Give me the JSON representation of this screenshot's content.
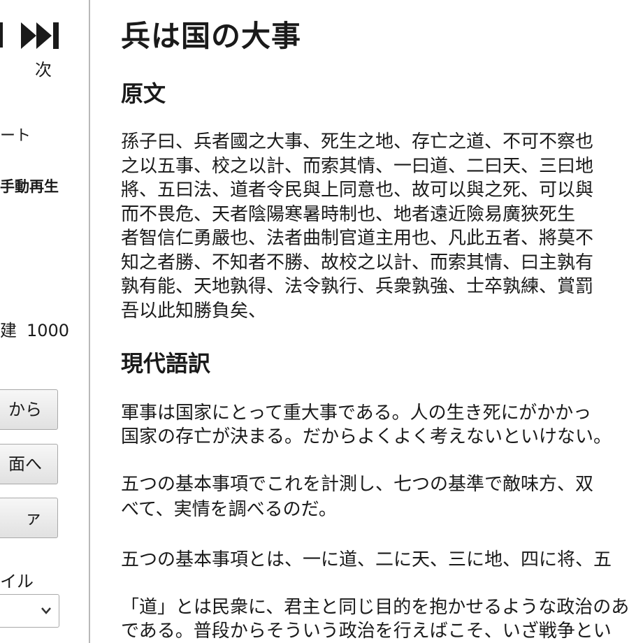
{
  "sidebar": {
    "next_label": "次",
    "start_label": "ート",
    "manual_play_label": "手動再生",
    "speed_label": "建",
    "speed_value": "1000",
    "buttons": [
      {
        "label": "から"
      },
      {
        "label": "面へ"
      },
      {
        "label": "ァ"
      }
    ],
    "style_label": "イル",
    "style_select_value": ""
  },
  "main": {
    "title": "兵は国の大事",
    "original_heading": "原文",
    "original_lines": [
      "孫子曰、兵者國之大事、死生之地、存亡之道、不可不察也",
      "之以五事、校之以計、而索其情、一曰道、二曰天、三曰地",
      "將、五曰法、道者令民與上同意也、故可以與之死、可以與",
      "而不畏危、天者陰陽寒暑時制也、地者遠近險易廣狹死生",
      "者智信仁勇嚴也、法者曲制官道主用也、凡此五者、將莫不",
      "知之者勝、不知者不勝、故校之以計、而索其情、曰主孰有",
      "孰有能、天地孰得、法令孰行、兵衆孰強、士卒孰練、賞罰",
      "吾以此知勝負矣、"
    ],
    "modern_heading": "現代語訳",
    "modern_lines": [
      "軍事は国家にとって重大事である。人の生き死にがかかっ",
      "国家の存亡が決まる。だからよくよく考えないといけない。",
      "五つの基本事項でこれを計測し、七つの基準で敵味方、双",
      "べて、実情を調べるのだ。",
      "五つの基本事項とは、一に道、二に天、三に地、四に将、五",
      "「道」とは民衆に、君主と同じ目的を抱かせるような政治のあ",
      "である。普段からそういう政治を行えばこそ、いざ戦争とい"
    ]
  }
}
